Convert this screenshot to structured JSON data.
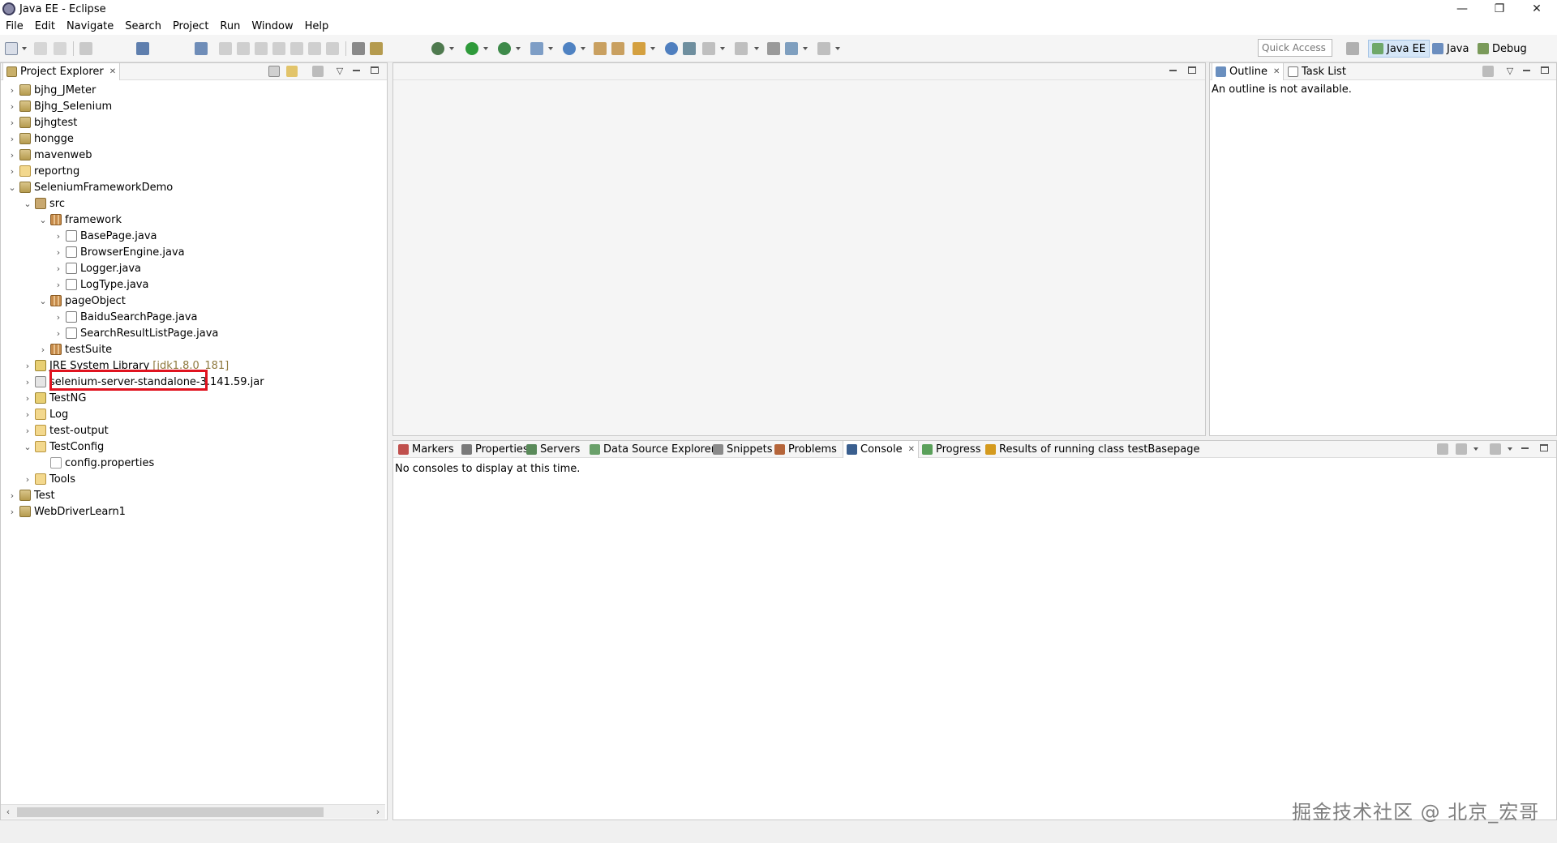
{
  "window": {
    "title": "Java EE - Eclipse",
    "minimize_glyph": "—",
    "restore_glyph": "❐",
    "close_glyph": "✕"
  },
  "menu": [
    "File",
    "Edit",
    "Navigate",
    "Search",
    "Project",
    "Run",
    "Window",
    "Help"
  ],
  "toolbar": {
    "quick_access_placeholder": "Quick Access",
    "perspectives": [
      {
        "label": "Java EE",
        "active": true,
        "color": "#6fa86a"
      },
      {
        "label": "Java",
        "active": false,
        "color": "#6c8ebf"
      },
      {
        "label": "Debug",
        "active": false,
        "color": "#7a9a5a"
      }
    ]
  },
  "project_explorer": {
    "tab_label": "Project Explorer",
    "close_glyph": "✕",
    "tree": [
      {
        "label": "bjhg_JMeter",
        "icon": "project",
        "expanded": false
      },
      {
        "label": "Bjhg_Selenium",
        "icon": "project",
        "expanded": false
      },
      {
        "label": "bjhgtest",
        "icon": "project",
        "expanded": false
      },
      {
        "label": "hongge",
        "icon": "project",
        "expanded": false
      },
      {
        "label": "mavenweb",
        "icon": "project",
        "expanded": false
      },
      {
        "label": "reportng",
        "icon": "folder",
        "expanded": false
      },
      {
        "label": "SeleniumFrameworkDemo",
        "icon": "project",
        "expanded": true
      },
      {
        "label": "src",
        "icon": "src",
        "expanded": true
      },
      {
        "label": "framework",
        "icon": "pkg",
        "expanded": true
      },
      {
        "label": "BasePage.java",
        "icon": "java",
        "expanded": false
      },
      {
        "label": "BrowserEngine.java",
        "icon": "java",
        "expanded": false
      },
      {
        "label": "Logger.java",
        "icon": "java",
        "expanded": false
      },
      {
        "label": "LogType.java",
        "icon": "java",
        "expanded": false
      },
      {
        "label": "pageObject",
        "icon": "pkg",
        "expanded": true
      },
      {
        "label": "BaiduSearchPage.java",
        "icon": "java",
        "expanded": false
      },
      {
        "label": "SearchResultListPage.java",
        "icon": "java",
        "expanded": false
      },
      {
        "label": "testSuite",
        "icon": "pkg",
        "expanded": false
      },
      {
        "label": "JRE System Library",
        "icon": "lib",
        "expanded": false,
        "decoration": "[jdk1.8.0_181]"
      },
      {
        "label": "selenium-server-standalone-3.141.59.jar",
        "icon": "jar",
        "expanded": false
      },
      {
        "label": "TestNG",
        "icon": "lib",
        "expanded": false
      },
      {
        "label": "Log",
        "icon": "folder",
        "expanded": false
      },
      {
        "label": "test-output",
        "icon": "folder",
        "expanded": false
      },
      {
        "label": "TestConfig",
        "icon": "folder",
        "expanded": true
      },
      {
        "label": "config.properties",
        "icon": "file",
        "leaf": true
      },
      {
        "label": "Tools",
        "icon": "folder",
        "expanded": false
      },
      {
        "label": "Test",
        "icon": "project",
        "expanded": false
      },
      {
        "label": "WebDriverLearn1",
        "icon": "project",
        "expanded": false
      }
    ],
    "highlighted_item": "BaiduSearchPage.java"
  },
  "outline": {
    "tabs": [
      {
        "label": "Outline",
        "active": true
      },
      {
        "label": "Task List",
        "active": false
      }
    ],
    "message": "An outline is not available."
  },
  "bottom_panel": {
    "tabs": [
      {
        "label": "Markers",
        "active": false,
        "color": "#c0504d"
      },
      {
        "label": "Properties",
        "active": false,
        "color": "#7a7a7a"
      },
      {
        "label": "Servers",
        "active": false,
        "color": "#5a8a5a"
      },
      {
        "label": "Data Source Explorer",
        "active": false,
        "color": "#6aa06a"
      },
      {
        "label": "Snippets",
        "active": false,
        "color": "#8a8a8a"
      },
      {
        "label": "Problems",
        "active": false,
        "color": "#b5653a"
      },
      {
        "label": "Console",
        "active": true,
        "color": "#3a5f8f"
      },
      {
        "label": "Progress",
        "active": false,
        "color": "#5aa05a"
      },
      {
        "label": "Results of running class testBasepage",
        "active": false,
        "color": "#d49a1e"
      }
    ],
    "console_message": "No consoles to display at this time."
  },
  "watermark": "掘金技术社区 @ 北京_宏哥"
}
